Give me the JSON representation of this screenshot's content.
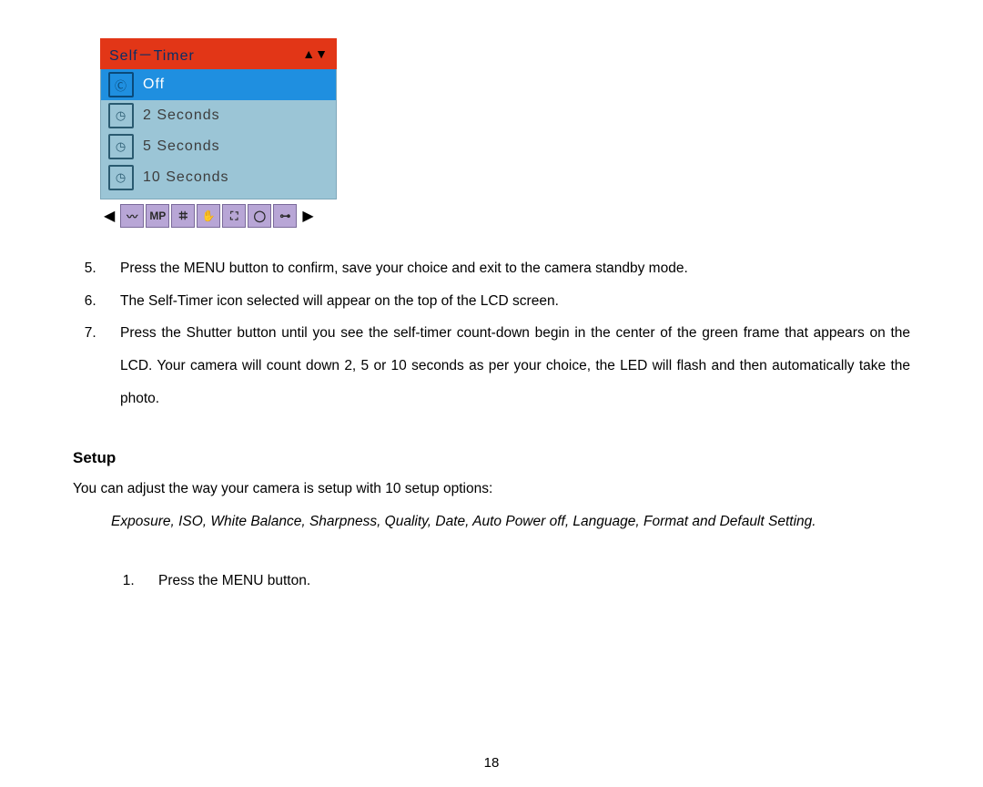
{
  "menu": {
    "title": "Self－Timer",
    "arrows": "▲▼",
    "options": [
      {
        "icon": "Ⓒ",
        "label": "Off",
        "selected": true
      },
      {
        "icon": "◷",
        "label": "2  Seconds",
        "selected": false
      },
      {
        "icon": "◷",
        "label": "5  Seconds",
        "selected": false
      },
      {
        "icon": "◷",
        "label": "10  Seconds",
        "selected": false
      }
    ],
    "strip": {
      "left": "◀",
      "icons": [
        "〰",
        "MP",
        "ꖛ",
        "✋",
        "⛶",
        "◯",
        "⊶"
      ],
      "right": "▶"
    }
  },
  "steps": {
    "start": 5,
    "items": [
      "Press the MENU button to confirm, save your choice and exit to the camera standby mode.",
      "The Self-Timer icon selected will appear on the top of the LCD screen.",
      "Press the Shutter button until you see the self-timer count-down begin in the center of the green frame that appears on the LCD. Your camera will count down 2, 5 or 10 seconds as per your choice, the LED will flash and then automatically take the photo."
    ]
  },
  "setup": {
    "heading": "Setup",
    "intro": "You can adjust the way your camera is setup with 10 setup options:",
    "options_text": "Exposure, ISO, White Balance, Sharpness, Quality, Date, Auto Power off, Language, Format and Default Setting.",
    "steps": {
      "start": 1,
      "items": [
        "Press the MENU button."
      ]
    }
  },
  "page_number": "18"
}
